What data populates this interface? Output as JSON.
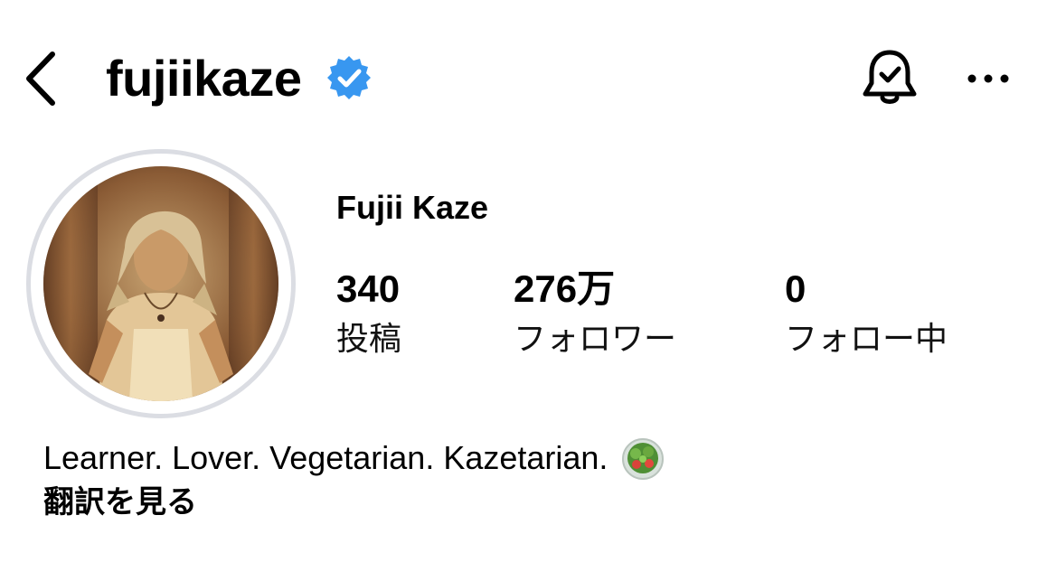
{
  "header": {
    "username": "fujiikaze"
  },
  "profile": {
    "display_name": "Fujii Kaze",
    "stats": {
      "posts_count": "340",
      "posts_label": "投稿",
      "followers_count": "276万",
      "followers_label": "フォロワー",
      "following_count": "0",
      "following_label": "フォロー中"
    },
    "bio": "Learner. Lover. Vegetarian. Kazetarian.",
    "translate_label": "翻訳を見る"
  },
  "icons": {
    "back": "chevron-left-icon",
    "verified": "verified-badge-icon",
    "notifications": "bell-check-icon",
    "more": "more-horizontal-icon",
    "bio_emoji": "salad-icon"
  },
  "colors": {
    "verified": "#3897f0",
    "avatar_ring": "#dbdde3"
  }
}
